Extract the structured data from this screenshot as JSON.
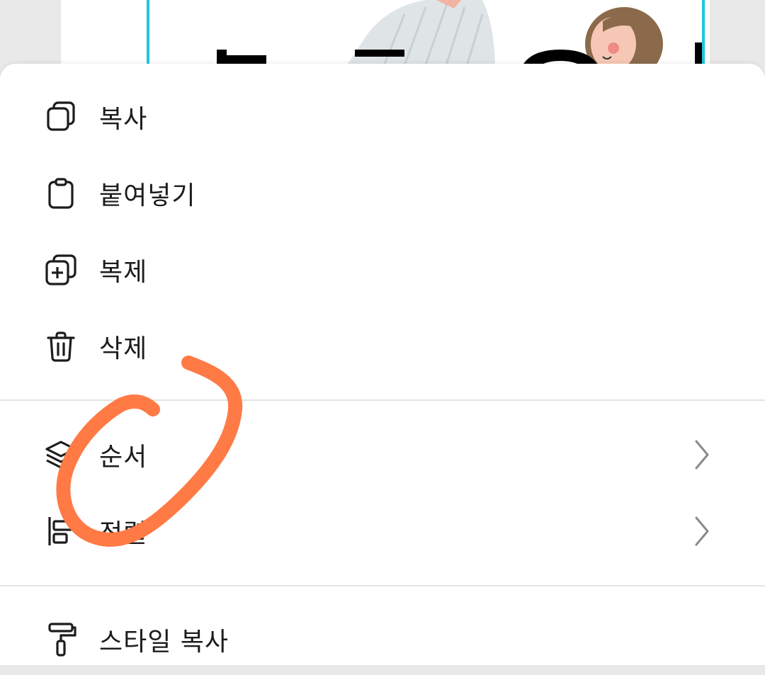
{
  "menu": {
    "items": [
      {
        "label": "복사",
        "icon": "copy-icon"
      },
      {
        "label": "붙여넣기",
        "icon": "clipboard-icon"
      },
      {
        "label": "복제",
        "icon": "duplicate-icon"
      },
      {
        "label": "삭제",
        "icon": "trash-icon"
      },
      {
        "label": "순서",
        "icon": "layers-icon",
        "submenu": true
      },
      {
        "label": "정렬",
        "icon": "align-icon",
        "submenu": true
      },
      {
        "label": "스타일 복사",
        "icon": "paint-roller-icon"
      }
    ]
  },
  "colors": {
    "annotation_stroke": "#ff7a45",
    "frame_border": "#1fc6e0",
    "icon": "#1c1c1c",
    "chevron": "#8a8a8a"
  }
}
